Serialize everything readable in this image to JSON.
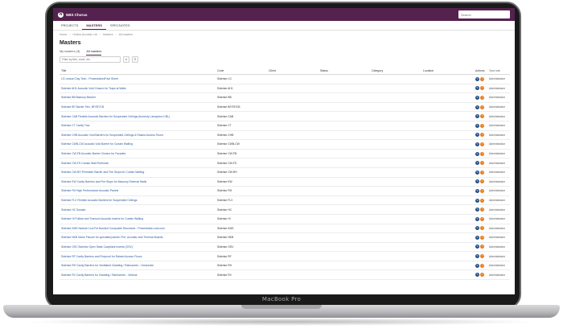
{
  "device": {
    "brand": "MacBook Pro"
  },
  "app": {
    "name": "NBS Chorus",
    "logo_glyph": "N"
  },
  "search": {
    "placeholder": "Search"
  },
  "nav": {
    "tabs": [
      "PROJECTS",
      "MASTERS",
      "SPECNOTES"
    ]
  },
  "breadcrumb": [
    "Home",
    "Hollow Acoustic Ltd",
    "Masters",
    "All masters"
  ],
  "page": {
    "title": "Masters"
  },
  "subtabs": [
    "My masters (3)",
    "All masters"
  ],
  "filter": {
    "placeholder": "Filter by title, code, etc"
  },
  "table": {
    "columns": [
      "Title",
      "Code",
      "Client",
      "Status",
      "Category",
      "Location",
      "Actions",
      "Your role"
    ],
    "role_value": "Administrator",
    "rows": [
      {
        "title": "LG Lesson Day Tech - Presentation/Fact Sheet",
        "code": "Siderise LG"
      },
      {
        "title": "Siderise AH1 Acoustic Void Closure for Traps at Walls",
        "code": "Siderise AH1"
      },
      {
        "title": "Siderise BB Balcony Blocker",
        "code": "Siderise BB"
      },
      {
        "title": "Siderise BF Barrier Flex, BF/SF/CB",
        "code": "Siderise BF/SF/CB"
      },
      {
        "title": "Siderise CAB Flexible Acoustic Barriers for Suspended Ceilings (formerly Lamaphon CBL)",
        "code": "Siderise CAB"
      },
      {
        "title": "Siderise CT Cavity Trac",
        "code": "Siderise CT"
      },
      {
        "title": "Siderise CHB Acoustic Void Barriers for Suspended Ceilings & Raised Access Floors",
        "code": "Siderise CHB"
      },
      {
        "title": "Siderise CWB-CW Acoustic Void Barrier for Curtain Walling",
        "code": "Siderise CWB-CW"
      },
      {
        "title": "Siderise CW-FB Acoustic Barrier Closers for Facades",
        "code": "Siderise CW-FB"
      },
      {
        "title": "Siderise CW-FS Curtain Wall Firebreak",
        "code": "Siderise CW-FS"
      },
      {
        "title": "Siderise CW-RH Perimeter Barrier and Fire Stops for Curtain Walling",
        "code": "Siderise CW-RH"
      },
      {
        "title": "Siderise EW Cavity Barriers and Fire Stops for Masonry External Walls",
        "code": "Siderise EW"
      },
      {
        "title": "Siderise FM High Performance Acoustic Panels",
        "code": "Siderise FM"
      },
      {
        "title": "Siderise FLX Flexible Acoustic Barriers for Suspended Ceilings",
        "code": "Siderise FLX"
      },
      {
        "title": "Siderise HC Sustain",
        "code": "Siderise HC"
      },
      {
        "title": "Siderise HI Fullbar and Transom Acoustic Inserts for Curtain Walling",
        "code": "Siderise HI"
      },
      {
        "title": "Siderise KMS Natural Cool Pol Bonded Composite Structures - Presentation.cost.com",
        "code": "Siderise KMS"
      },
      {
        "title": "Siderise NKB Noise Fissure for specialist panels: Fire, Acoustic and Thermal Boards",
        "code": "Siderise NKB"
      },
      {
        "title": "Siderise OSV Siderise Open State Cavipliant Inserts (OSV)",
        "code": "Siderise OSV"
      },
      {
        "title": "Siderise RF Cavity Barriers and Fireproof for Raised Access Floors",
        "code": "Siderise RF"
      },
      {
        "title": "Siderise RH Cavity Barriers for Ventilated Cladding / Rainscreen - Horizontal",
        "code": "Siderise RH"
      },
      {
        "title": "Siderise RV Cavity Barriers for Cladding / Rainscreen - Vertical",
        "code": "Siderise RV"
      }
    ]
  }
}
